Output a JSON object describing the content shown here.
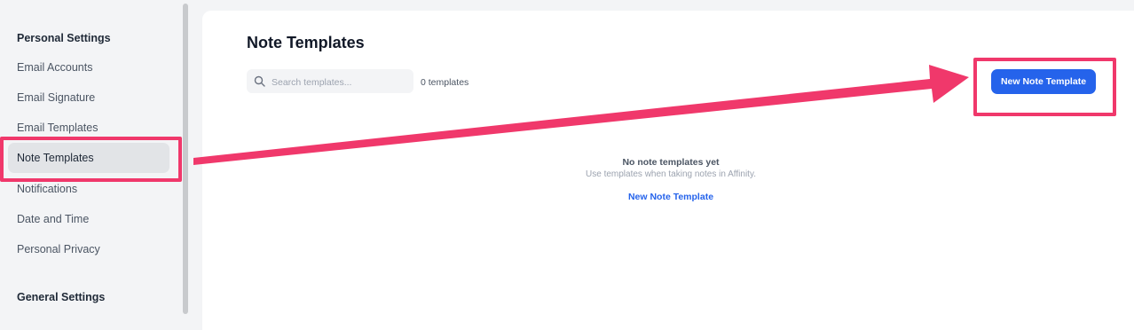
{
  "sidebar": {
    "personal_heading": "Personal Settings",
    "items": [
      {
        "label": "Email Accounts"
      },
      {
        "label": "Email Signature"
      },
      {
        "label": "Email Templates"
      },
      {
        "label": "Note Templates",
        "active": true
      },
      {
        "label": "Notifications"
      },
      {
        "label": "Date and Time"
      },
      {
        "label": "Personal Privacy"
      }
    ],
    "general_heading": "General Settings"
  },
  "main": {
    "title": "Note Templates",
    "search": {
      "placeholder": "Search templates...",
      "value": ""
    },
    "count": "0 templates",
    "new_button_label": "New Note Template",
    "empty_state": {
      "title": "No note templates yet",
      "subtitle": "Use templates when taking notes in Affinity.",
      "link_label": "New Note Template"
    }
  },
  "annotation": {
    "color": "#f0386b",
    "arrow": "from Note Templates sidebar item to New Note Template button"
  },
  "colors": {
    "accent": "#2563eb",
    "annotation": "#f0386b",
    "sidebar_bg": "#f3f4f6",
    "active_item_bg": "#e2e4e7"
  },
  "icons": {
    "search": "search-icon"
  }
}
